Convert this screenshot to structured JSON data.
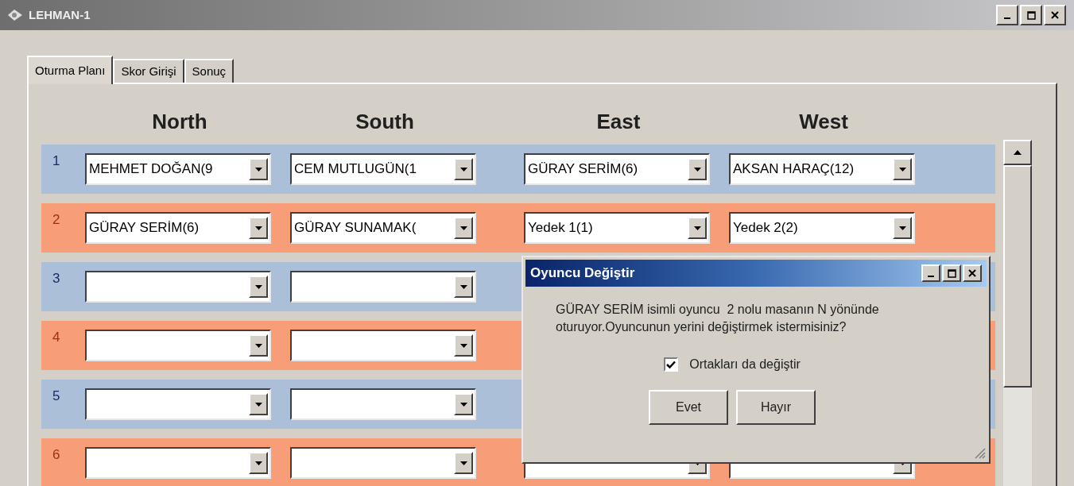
{
  "window": {
    "title": "LEHMAN-1"
  },
  "tabs": [
    {
      "label": "Oturma Planı",
      "selected": true
    },
    {
      "label": "Skor Girişi",
      "selected": false
    },
    {
      "label": "Sonuç",
      "selected": false
    }
  ],
  "columns": [
    "North",
    "South",
    "East",
    "West"
  ],
  "rows": [
    {
      "number": "1",
      "color": "#abbfd9",
      "north": "MEHMET DOĞAN(9",
      "south": "CEM MUTLUGÜN(1",
      "east": "GÜRAY SERİM(6)",
      "west": "AKSAN HARAÇ(12)"
    },
    {
      "number": "2",
      "color": "#f79e78",
      "north": "GÜRAY SERİM(6)",
      "south": "GÜRAY SUNAMAK(",
      "east": "Yedek 1(1)",
      "west": "Yedek 2(2)"
    },
    {
      "number": "3",
      "color": "#abbfd9"
    },
    {
      "number": "4",
      "color": "#f79e78"
    },
    {
      "number": "5",
      "color": "#abbfd9"
    },
    {
      "number": "6",
      "color": "#f79e78"
    }
  ],
  "dialog": {
    "title": "Oyuncu Değiştir",
    "message": "GÜRAY SERİM isimli oyuncu  2 nolu masanın N yönünde oturuyor.Oyuncunun yerini değiştirmek istermisiniz?",
    "checkbox": {
      "label": "Ortakları da değiştir",
      "checked": true
    },
    "buttons": [
      "Evet",
      "Hayır"
    ]
  }
}
